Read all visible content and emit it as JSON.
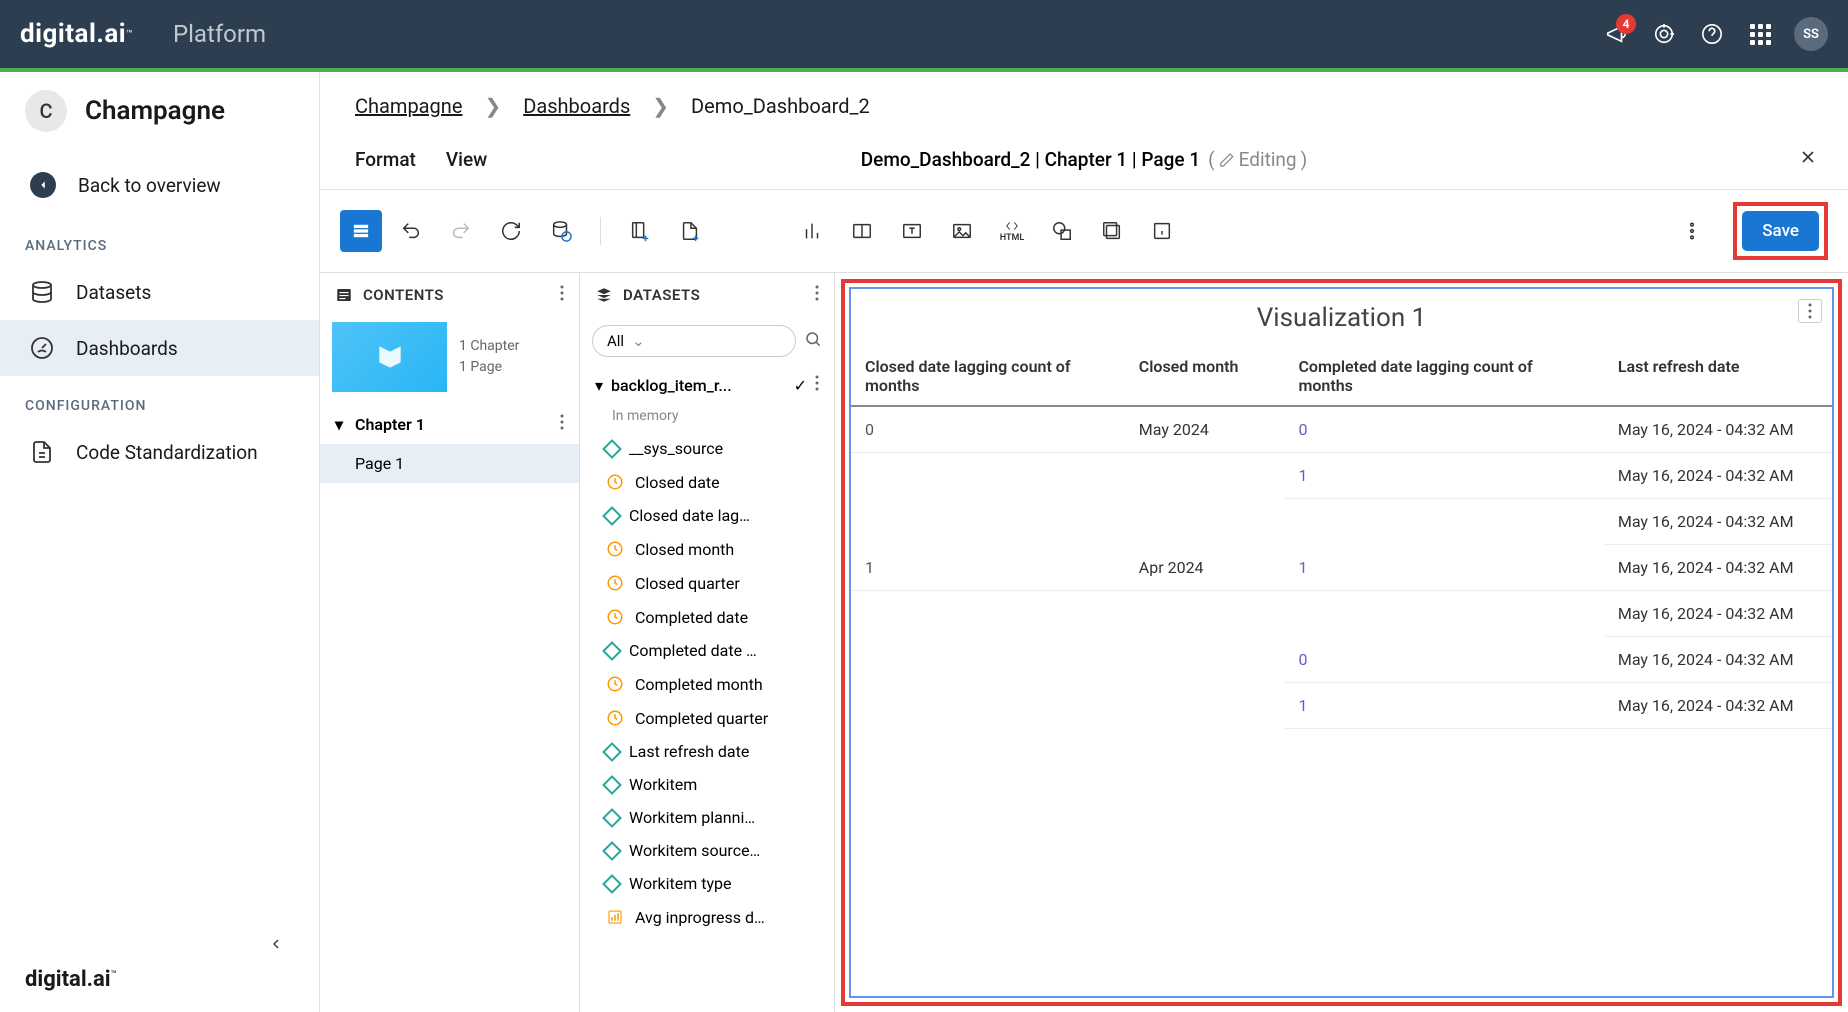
{
  "header": {
    "logo_bold": "digital.ai",
    "platform": "Platform",
    "badge_count": "4",
    "avatar": "SS"
  },
  "sidebar": {
    "project_letter": "C",
    "project_name": "Champagne",
    "back_label": "Back to overview",
    "section_analytics": "ANALYTICS",
    "section_config": "CONFIGURATION",
    "nav_datasets": "Datasets",
    "nav_dashboards": "Dashboards",
    "nav_code_std": "Code Standardization",
    "footer_logo": "digital.ai"
  },
  "breadcrumb": {
    "item1": "Champagne",
    "item2": "Dashboards",
    "item3": "Demo_Dashboard_2"
  },
  "menu": {
    "format": "Format",
    "view": "View",
    "doc_title": "Demo_Dashboard_2 | Chapter 1 | Page 1",
    "editing": "Editing"
  },
  "toolbar": {
    "save": "Save",
    "html": "HTML"
  },
  "contents": {
    "title": "CONTENTS",
    "meta1": "1 Chapter",
    "meta2": "1 Page",
    "chapter": "Chapter 1",
    "page": "Page 1"
  },
  "datasets": {
    "title": "DATASETS",
    "filter_all": "All",
    "ds_name": "backlog_item_r...",
    "memory": "In memory",
    "fields": [
      {
        "icon": "diamond",
        "label": "__sys_source"
      },
      {
        "icon": "clock",
        "label": "Closed date"
      },
      {
        "icon": "diamond",
        "label": "Closed date lag…"
      },
      {
        "icon": "clock",
        "label": "Closed month"
      },
      {
        "icon": "clock",
        "label": "Closed quarter"
      },
      {
        "icon": "clock",
        "label": "Completed date"
      },
      {
        "icon": "diamond",
        "label": "Completed date …"
      },
      {
        "icon": "clock",
        "label": "Completed month"
      },
      {
        "icon": "clock",
        "label": "Completed quarter"
      },
      {
        "icon": "diamond",
        "label": "Last refresh date"
      },
      {
        "icon": "diamond",
        "label": "Workitem"
      },
      {
        "icon": "diamond",
        "label": "Workitem planni…"
      },
      {
        "icon": "diamond",
        "label": "Workitem source…"
      },
      {
        "icon": "diamond",
        "label": "Workitem type"
      },
      {
        "icon": "num",
        "label": "Avg inprogress d…"
      }
    ]
  },
  "viz": {
    "title": "Visualization 1",
    "heads": {
      "h1": "Closed date lagging count of months",
      "h2": "Closed month",
      "h3": "Completed date lagging count of months",
      "h4": "Last refresh date"
    },
    "rows": [
      {
        "c1": "0",
        "c2": "May 2024",
        "c3": "0",
        "c4": "May 16, 2024 - 04:32 AM"
      },
      {
        "c1": "",
        "c2": "",
        "c3": "1",
        "c4": "May 16, 2024 - 04:32 AM"
      },
      {
        "c1": "",
        "c2": "",
        "c3": "",
        "c4": "May 16, 2024 - 04:32 AM"
      },
      {
        "c1": "1",
        "c2": "Apr 2024",
        "c3": "1",
        "c4": "May 16, 2024 - 04:32 AM"
      },
      {
        "c1": "",
        "c2": "",
        "c3": "",
        "c4": "May 16, 2024 - 04:32 AM"
      },
      {
        "c1": "",
        "c2": "",
        "c3": "0",
        "c4": "May 16, 2024 - 04:32 AM"
      },
      {
        "c1": "",
        "c2": "",
        "c3": "1",
        "c4": "May 16, 2024 - 04:32 AM"
      }
    ]
  }
}
